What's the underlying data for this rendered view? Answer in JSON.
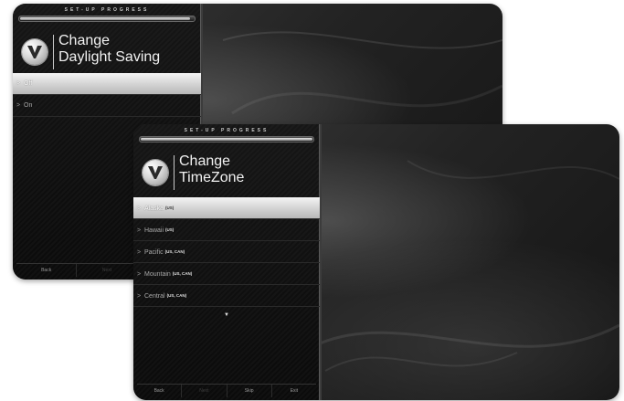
{
  "back_dialog": {
    "progress_label": "SET-UP PROGRESS",
    "progress": 0.97,
    "title_line1": "Change",
    "title_line2": "Daylight Saving",
    "items": [
      {
        "label": "Off",
        "selected": true
      },
      {
        "label": "On",
        "selected": false
      }
    ],
    "footer": {
      "back": "Back",
      "next": "Next",
      "skip": "Sk"
    }
  },
  "front_dialog": {
    "progress_label": "SET-UP PROGRESS",
    "progress": 0.99,
    "title_line1": "Change",
    "title_line2": "TimeZone",
    "items": [
      {
        "label": "Alaska",
        "region": "(US)",
        "selected": true
      },
      {
        "label": "Hawaii",
        "region": "(US)",
        "selected": false
      },
      {
        "label": "Pacific",
        "region": "(US, CAN)",
        "selected": false
      },
      {
        "label": "Mountain",
        "region": "(US, CAN)",
        "selected": false
      },
      {
        "label": "Central",
        "region": "(US, CAN)",
        "selected": false
      }
    ],
    "scroll_icon": "chevron-down-icon",
    "footer": {
      "back": "Back",
      "next": "Next",
      "skip": "Skip",
      "exit": "Exit"
    }
  },
  "colors": {
    "selected_highlight": "#e6e6e6",
    "panel_background": "#101010",
    "screen_background": "#2a2a2a"
  },
  "logo_icon": "vizio-v-logo-icon"
}
